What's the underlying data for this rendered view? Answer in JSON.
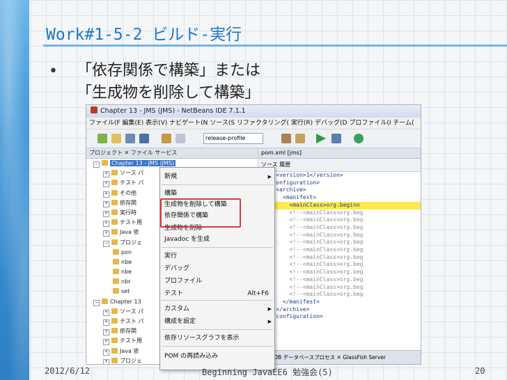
{
  "slide": {
    "title": "Work#1-5-2 ビルド-実行",
    "bullet_symbol": "•",
    "bullet_line1": "「依存関係で構築」または",
    "bullet_line2": "「生成物を削除して構築」",
    "footer_date": "2012/6/12",
    "footer_center": "Beginning JavaEE6 勉強会(5)",
    "footer_page": "20"
  },
  "ide": {
    "window_title": "Chapter 13 - JMS (JMS) - NetBeans IDE 7.1.1",
    "menubar": "ファイル(F 編集(E) 表示(V) ナビゲート(N ソース(S リファクタリング( 実行(R) デバッグ(D プロファイル(I チーム(",
    "config_combo": "release-profile",
    "left_tabs": "プロジェクト ✕  ファイル  サービス",
    "tree": [
      {
        "expander": "−",
        "label": "Chapter 13 - JMS (JMS)",
        "indent": 0,
        "selected": true
      },
      {
        "expander": "+",
        "label": "ソース パ",
        "indent": 1
      },
      {
        "expander": "+",
        "label": "テスト パ",
        "indent": 1
      },
      {
        "expander": "+",
        "label": "その他",
        "indent": 1
      },
      {
        "expander": "+",
        "label": "依存関",
        "indent": 1
      },
      {
        "expander": "+",
        "label": "実行時",
        "indent": 1
      },
      {
        "expander": "+",
        "label": "テスト用",
        "indent": 1
      },
      {
        "expander": "+",
        "label": "Java 依",
        "indent": 1
      },
      {
        "expander": "−",
        "label": "プロジェ",
        "indent": 1
      },
      {
        "expander": "",
        "label": "pon",
        "indent": 2
      },
      {
        "expander": "",
        "label": "nbe",
        "indent": 2
      },
      {
        "expander": "",
        "label": "nbe",
        "indent": 2
      },
      {
        "expander": "",
        "label": "nbr",
        "indent": 2
      },
      {
        "expander": "",
        "label": "set",
        "indent": 2
      },
      {
        "expander": "−",
        "label": "Chapter 13",
        "indent": 0
      },
      {
        "expander": "+",
        "label": "ソース パ",
        "indent": 1
      },
      {
        "expander": "+",
        "label": "テスト パ",
        "indent": 1
      },
      {
        "expander": "+",
        "label": "依存関",
        "indent": 1
      },
      {
        "expander": "+",
        "label": "テスト用",
        "indent": 1
      },
      {
        "expander": "+",
        "label": "Java 依",
        "indent": 1
      },
      {
        "expander": "+",
        "label": "プロジェ",
        "indent": 1
      }
    ],
    "editor_tab": "pom.xml [jms]",
    "editor_toolbar": "ソース  履歴",
    "code_lines": [
      {
        "text": "    <version>1</version>",
        "type": "tag"
      },
      {
        "text": "  <configuration>",
        "type": "tag"
      },
      {
        "text": "    <archive>",
        "type": "tag"
      },
      {
        "text": "      <manifest>",
        "type": "tag"
      },
      {
        "text": "        <mainClass>org.beginn",
        "type": "hl"
      },
      {
        "text": "        <!--<mainClass>org.beg",
        "type": "cm"
      },
      {
        "text": "        <!--<mainClass>org.beg",
        "type": "cm"
      },
      {
        "text": "        <!--<mainClass>org.beg",
        "type": "cm"
      },
      {
        "text": "        <!--<mainClass>org.beg",
        "type": "cm"
      },
      {
        "text": "        <!--<mainClass>org.beg",
        "type": "cm"
      },
      {
        "text": "        <!--<mainClass>org.beg",
        "type": "cm"
      },
      {
        "text": "        <!--<mainClass>org.beg",
        "type": "cm"
      },
      {
        "text": "        <!--<mainClass>org.beg",
        "type": "cm"
      },
      {
        "text": "        <!--<mainClass>org.beg",
        "type": "cm"
      },
      {
        "text": "        <!--<mainClass>org.beg",
        "type": "cm"
      },
      {
        "text": "        <!--<mainClass>org.beg",
        "type": "cm"
      },
      {
        "text": "        <!--<mainClass>org.beg",
        "type": "cm"
      },
      {
        "text": "      </manifest>",
        "type": "tag"
      },
      {
        "text": "    </archive>",
        "type": "tag"
      },
      {
        "text": "  </configuration>",
        "type": "tag"
      }
    ],
    "bottom_tabs": "Java DB データベースプロセス ✕  GlassFish Server"
  },
  "context_menu": {
    "items": [
      {
        "label": "新規",
        "submenu": true
      },
      {
        "label": "構築"
      },
      {
        "label": "生成物を削除して構築"
      },
      {
        "label": "依存関係で構築"
      },
      {
        "label": "生成物を削除"
      },
      {
        "label": "Javadoc を生成"
      },
      {
        "label": "実行"
      },
      {
        "label": "デバッグ"
      },
      {
        "label": "プロファイル"
      },
      {
        "label": "テスト",
        "shortcut": "Alt+F6"
      },
      {
        "label": "カスタム",
        "submenu": true
      },
      {
        "label": "構成を設定",
        "submenu": true
      },
      {
        "label": "依存リソースグラフを表示"
      },
      {
        "label": "POM の再読み込み"
      }
    ],
    "submenu_arrow": "▶"
  },
  "colors": {
    "title": "#1f77c9",
    "highlight_box": "#d83a3a",
    "accent": "#3d94d6"
  }
}
